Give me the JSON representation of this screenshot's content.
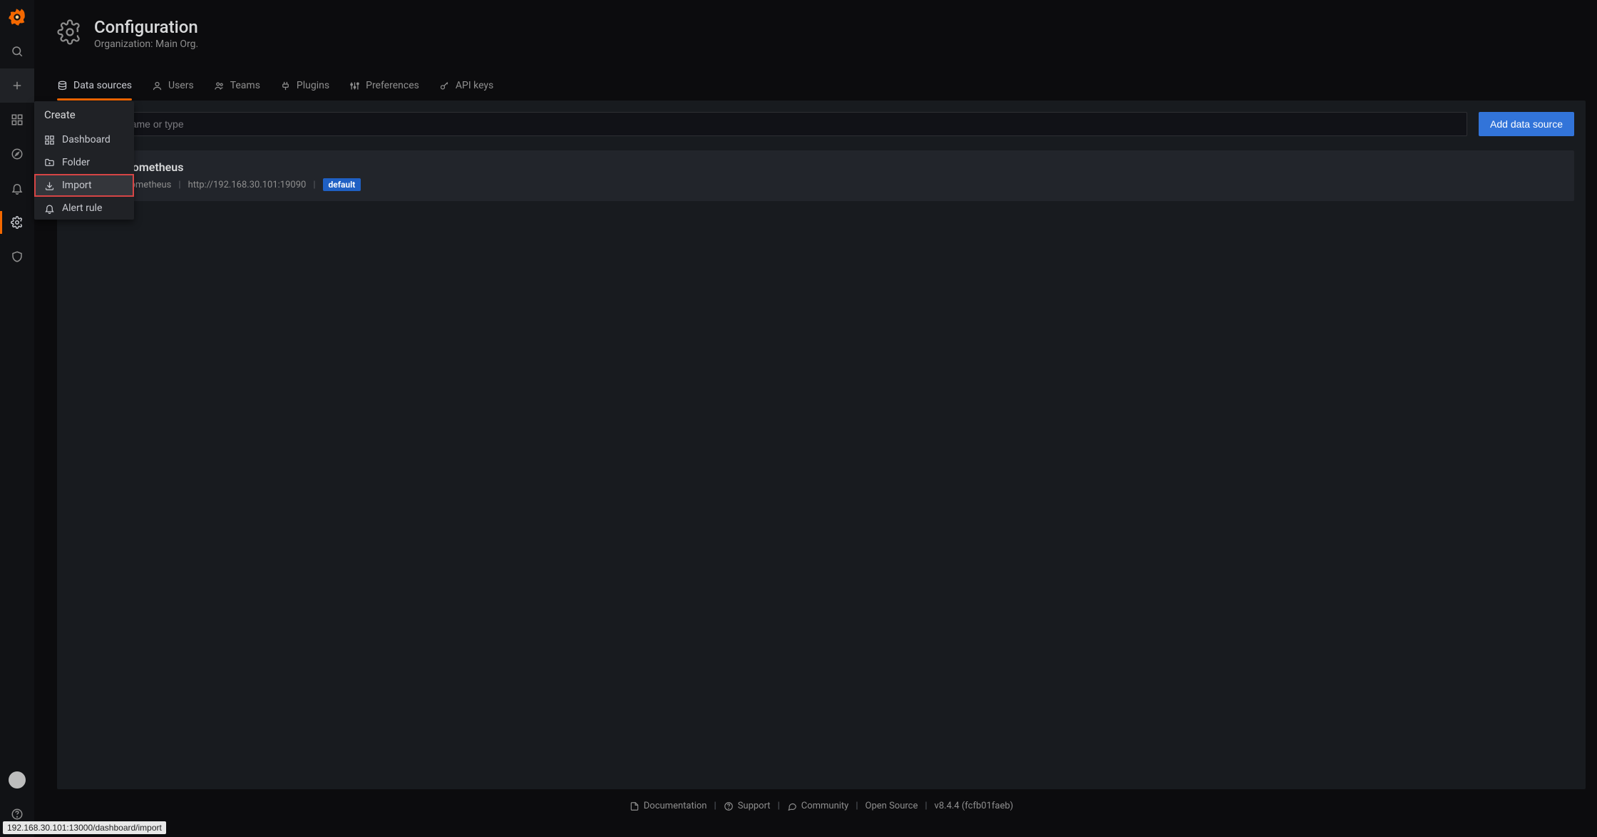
{
  "sidebar": {
    "logo_color": "#f46800"
  },
  "flyout": {
    "title": "Create",
    "items": [
      {
        "label": "Dashboard"
      },
      {
        "label": "Folder"
      },
      {
        "label": "Import"
      },
      {
        "label": "Alert rule"
      }
    ],
    "highlight_index": 2
  },
  "page": {
    "title": "Configuration",
    "subtitle": "Organization: Main Org."
  },
  "tabs": [
    {
      "label": "Data sources"
    },
    {
      "label": "Users"
    },
    {
      "label": "Teams"
    },
    {
      "label": "Plugins"
    },
    {
      "label": "Preferences"
    },
    {
      "label": "API keys"
    }
  ],
  "active_tab_index": 0,
  "search": {
    "placeholder": "Search by name or type"
  },
  "buttons": {
    "add_ds": "Add data source"
  },
  "datasource": {
    "name": "Prometheus",
    "type": "Prometheus",
    "url": "http://192.168.30.101:19090",
    "badge": "default"
  },
  "separator": "|",
  "footer": {
    "doc": "Documentation",
    "support": "Support",
    "community": "Community",
    "license": "Open Source",
    "version": "v8.4.4 (fcfb01faeb)"
  },
  "status_tip": "192.168.30.101:13000/dashboard/import"
}
